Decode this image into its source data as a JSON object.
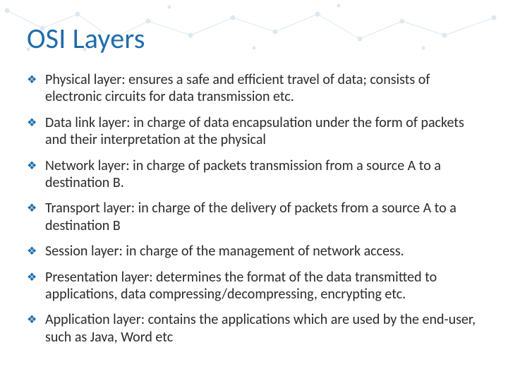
{
  "slide": {
    "title": "OSI Layers",
    "bullets": [
      {
        "text": "Physical layer: ensures a safe and efficient travel of data; consists of electronic circuits for data transmission etc."
      },
      {
        "text": "Data link layer: in charge of data encapsulation under the form of packets and their interpretation at the physical"
      },
      {
        "text": "Network layer: in charge of packets transmission from a source A to a destination B."
      },
      {
        "text": "Transport layer: in charge of the delivery of packets from a source A to a destination B"
      },
      {
        "text": "Session layer: in charge of the management of network access."
      },
      {
        "text": "Presentation layer: determines the format of the data transmitted to applications, data compressing/decompressing, encrypting etc."
      },
      {
        "text": "Application layer: contains the applications which are used by the end-user, such as Java, Word etc"
      }
    ],
    "bullet_glyph": "❖",
    "accent_color": "#1f6cab"
  }
}
